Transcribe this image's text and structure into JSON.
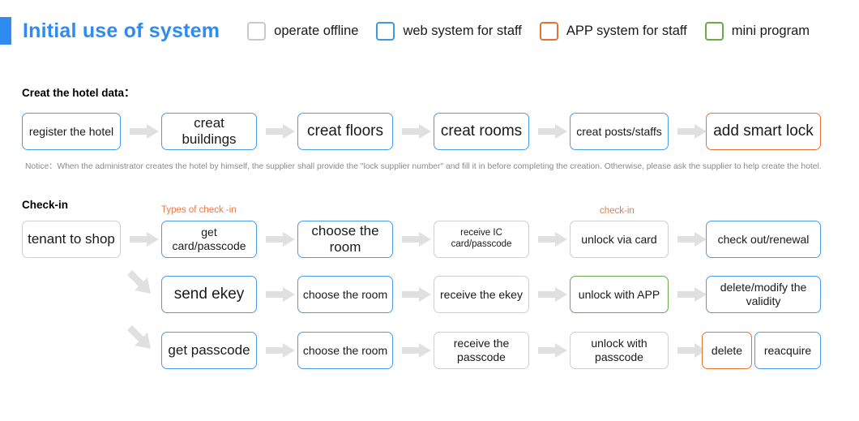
{
  "header": {
    "title": "Initial use of system",
    "accent_color": "#2E8BF0",
    "legend": [
      {
        "label": "operate offline",
        "swatch": "checkbox-grey",
        "color": "#c9c9c9"
      },
      {
        "label": "web system for staff",
        "swatch": "checkbox-blue",
        "color": "#3E97E8"
      },
      {
        "label": "APP system for staff",
        "swatch": "checkbox-orange",
        "color": "#E1742E"
      },
      {
        "label": "mini program",
        "swatch": "checkbox-green",
        "color": "#6CA94A"
      }
    ]
  },
  "sections": {
    "hotel_data": {
      "heading": "Creat the hotel data：",
      "steps": [
        {
          "label": "register the hotel",
          "color": "blue",
          "size": "fs-md"
        },
        {
          "label": "creat buildings",
          "color": "blue",
          "size": "fs-lg"
        },
        {
          "label": "creat floors",
          "color": "blue",
          "size": "fs-xl"
        },
        {
          "label": "creat rooms",
          "color": "blue",
          "size": "fs-xl"
        },
        {
          "label": "creat posts/staffs",
          "color": "blue",
          "size": "fs-md"
        },
        {
          "label": "add smart lock",
          "color": "orange",
          "size": "fs-xl"
        }
      ],
      "notice": "Notice：When the administrator creates the hotel by himself, the supplier shall provide the \"lock supplier number\" and fill it in before completing the creation. Otherwise, please ask the supplier to help create the hotel."
    },
    "check_in": {
      "heading": "Check-in",
      "captions": [
        {
          "text": "Types of check -in",
          "color": "#E8794A"
        },
        {
          "text": "check-in",
          "color": "#E8794A"
        }
      ],
      "entry": {
        "label": "tenant to shop",
        "color": "grey",
        "size": "fs-lg"
      },
      "rows": [
        {
          "steps": [
            {
              "label": "get card/passcode",
              "color": "blue",
              "size": "fs-md"
            },
            {
              "label": "choose the room",
              "color": "blue",
              "size": "fs-lg"
            },
            {
              "label": "receive IC card/passcode",
              "color": "grey",
              "size": "fs-sm"
            },
            {
              "label": "unlock via card",
              "color": "grey",
              "size": "fs-md"
            },
            {
              "label": "check out/renewal",
              "color": "blue",
              "size": "fs-md"
            }
          ]
        },
        {
          "steps": [
            {
              "label": "send ekey",
              "color": "blue",
              "size": "fs-xl"
            },
            {
              "label": "choose the room",
              "color": "blue",
              "size": "fs-md"
            },
            {
              "label": "receive the ekey",
              "color": "grey",
              "size": "fs-md"
            },
            {
              "label": "unlock with APP",
              "color": "green",
              "size": "fs-md"
            },
            {
              "label": "delete/modify the validity",
              "color": "blue",
              "size": "fs-md"
            }
          ]
        },
        {
          "steps": [
            {
              "label": "get passcode",
              "color": "blue",
              "size": "fs-lg"
            },
            {
              "label": "choose the room",
              "color": "blue",
              "size": "fs-md"
            },
            {
              "label": "receive the passcode",
              "color": "grey",
              "size": "fs-md"
            },
            {
              "label": "unlock with passcode",
              "color": "grey",
              "size": "fs-md"
            },
            {
              "label": "delete",
              "color": "orange",
              "size": "fs-md"
            },
            {
              "label": "reacquire",
              "color": "blue",
              "size": "fs-md"
            }
          ]
        }
      ]
    }
  }
}
